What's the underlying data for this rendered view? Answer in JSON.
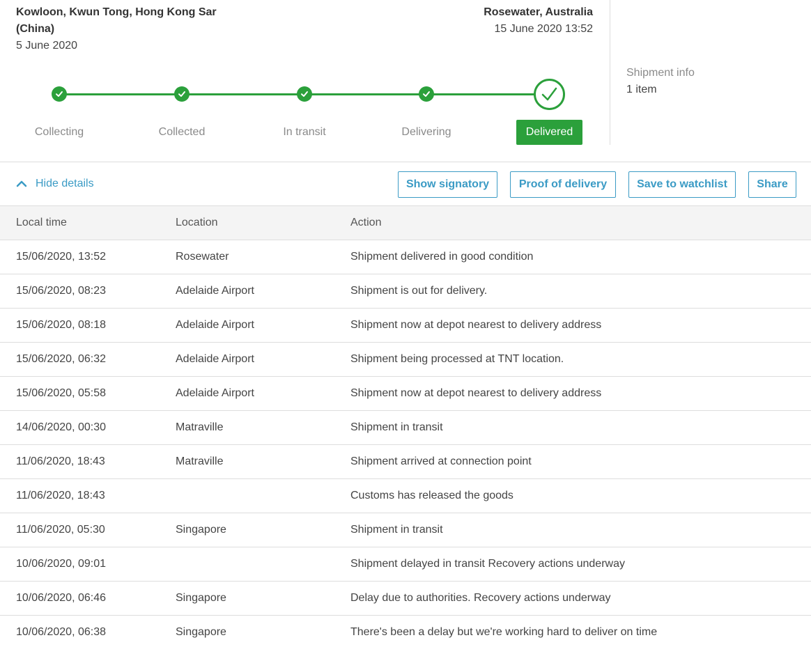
{
  "origin": {
    "place_line1": "Kowloon, Kwun Tong, Hong Kong Sar",
    "place_line2": "(China)",
    "date": "5 June 2020"
  },
  "destination": {
    "place": "Rosewater, Australia",
    "date": "15 June 2020 13:52"
  },
  "shipment_info": {
    "label": "Shipment info",
    "value": "1 item"
  },
  "progress": {
    "steps": [
      "Collecting",
      "Collected",
      "In transit",
      "Delivering",
      "Delivered"
    ],
    "current": "Delivered",
    "color": "#2ba03b"
  },
  "actions": {
    "hide_details": "Hide details",
    "show_signatory": "Show signatory",
    "proof_of_delivery": "Proof of delivery",
    "save_to_watchlist": "Save to watchlist",
    "share": "Share",
    "accent": "#3b9bc5"
  },
  "table": {
    "headers": [
      "Local time",
      "Location",
      "Action"
    ],
    "rows": [
      [
        "15/06/2020, 13:52",
        "Rosewater",
        "Shipment delivered in good condition"
      ],
      [
        "15/06/2020, 08:23",
        "Adelaide Airport",
        "Shipment is out for delivery."
      ],
      [
        "15/06/2020, 08:18",
        "Adelaide Airport",
        "Shipment now at depot nearest to delivery address"
      ],
      [
        "15/06/2020, 06:32",
        "Adelaide Airport",
        "Shipment being processed at TNT location."
      ],
      [
        "15/06/2020, 05:58",
        "Adelaide Airport",
        "Shipment now at depot nearest to delivery address"
      ],
      [
        "14/06/2020, 00:30",
        "Matraville",
        "Shipment in transit"
      ],
      [
        "11/06/2020, 18:43",
        "Matraville",
        "Shipment arrived at connection point"
      ],
      [
        "11/06/2020, 18:43",
        "",
        "Customs has released the goods"
      ],
      [
        "11/06/2020, 05:30",
        "Singapore",
        "Shipment in transit"
      ],
      [
        "10/06/2020, 09:01",
        "",
        "Shipment delayed in transit Recovery actions underway"
      ],
      [
        "10/06/2020, 06:46",
        "Singapore",
        "Delay due to authorities. Recovery actions underway"
      ],
      [
        "10/06/2020, 06:38",
        "Singapore",
        "There's been a delay but we're working hard to deliver on time"
      ]
    ]
  }
}
